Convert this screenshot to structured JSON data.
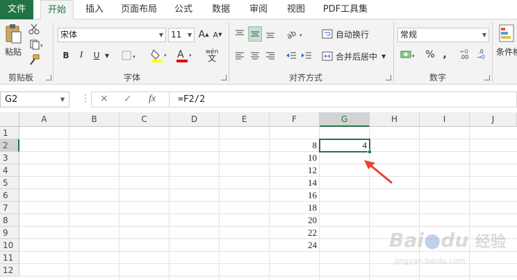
{
  "tabs": [
    {
      "label": "文件"
    },
    {
      "label": "开始"
    },
    {
      "label": "插入"
    },
    {
      "label": "页面布局"
    },
    {
      "label": "公式"
    },
    {
      "label": "数据"
    },
    {
      "label": "审阅"
    },
    {
      "label": "视图"
    },
    {
      "label": "PDF工具集"
    }
  ],
  "ribbon": {
    "clipboard": {
      "paste": "粘贴",
      "label": "剪贴板"
    },
    "font": {
      "name": "宋体",
      "size": "11",
      "bold": "B",
      "italic": "I",
      "underline": "U",
      "grow": "A",
      "shrink": "A",
      "font_color_glyph": "A",
      "phonetic": "wén",
      "label": "字体"
    },
    "alignment": {
      "wrap": "自动换行",
      "merge": "合并后居中",
      "label": "对齐方式"
    },
    "number": {
      "format": "常规",
      "percent": "%",
      "comma": ",",
      "inc_decimal": ".00",
      "dec_decimal": ".0",
      "label": "数字"
    },
    "styles": {
      "conditional": "条件格"
    }
  },
  "formula_bar": {
    "name_box": "G2",
    "cancel": "✕",
    "enter": "✓",
    "fx": "fx",
    "formula": "=F2/2"
  },
  "grid": {
    "columns": [
      "A",
      "B",
      "C",
      "D",
      "E",
      "F",
      "G",
      "H",
      "I",
      "J"
    ],
    "rows": [
      "1",
      "2",
      "3",
      "4",
      "5",
      "6",
      "7",
      "8",
      "9",
      "10",
      "11",
      "12"
    ],
    "selected_column": "G",
    "selected_row": "2",
    "column_F": [
      "8",
      "10",
      "12",
      "14",
      "16",
      "18",
      "20",
      "22",
      "24"
    ],
    "G2": "4"
  },
  "watermark": {
    "brand": "Bai",
    "paw": "du",
    "cn": "经验",
    "url": "jingyan.baidu.com"
  },
  "colors": {
    "accent": "#217346",
    "arrow": "#e8422f"
  }
}
